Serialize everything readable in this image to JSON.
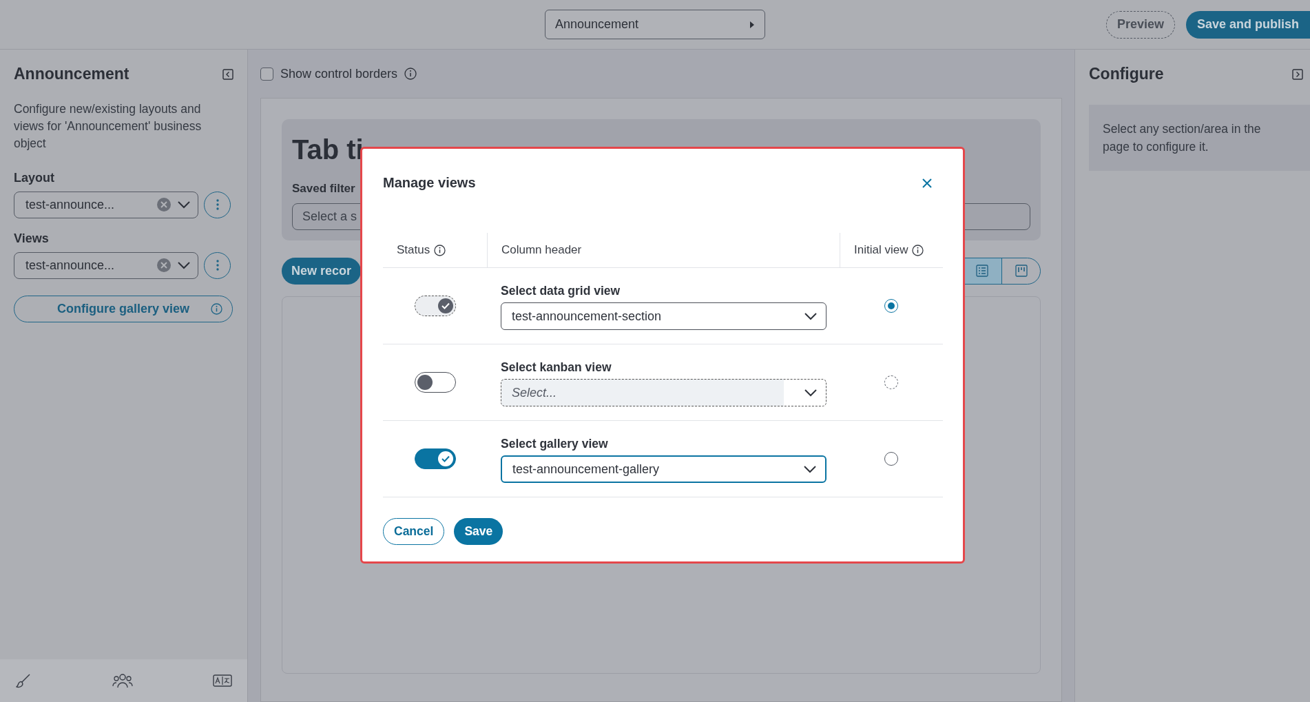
{
  "top_bar": {
    "object_selector": "Announcement",
    "buttons": [
      {
        "label": "Preview",
        "kind": "outline"
      },
      {
        "label": "Save and publish",
        "kind": "primary"
      }
    ]
  },
  "left_panel": {
    "title": "Announcement",
    "description": "Configure new/existing layouts and views for 'Announcement' business object",
    "fields": [
      {
        "label": "Layout",
        "value": "test-announce..."
      },
      {
        "label": "Views",
        "value": "test-announce..."
      }
    ],
    "configure_button": "Configure gallery view"
  },
  "canvas": {
    "show_borders": {
      "label": "Show control borders",
      "checked": false
    },
    "tab_title": "Tab ti",
    "filter_label": "Saved filter",
    "filter_placeholder": "Select a s",
    "new_button": "New recor",
    "view_toggle": [
      {
        "kind": "list",
        "selected": true
      },
      {
        "kind": "kanban",
        "selected": false
      }
    ]
  },
  "right_panel": {
    "title": "Configure",
    "hint": "Select any section/area in the page to configure it."
  },
  "dialog": {
    "title": "Manage views",
    "columns": [
      "Status",
      "Column header",
      "Initial view"
    ],
    "rows": [
      {
        "label": "Select data grid view",
        "toggle": {
          "on": true,
          "disabled": true
        },
        "select": {
          "value": "test-announcement-section",
          "disabled": false,
          "focused": false
        },
        "initial_view": {
          "selected": true,
          "disabled": false
        }
      },
      {
        "label": "Select kanban view",
        "toggle": {
          "on": false,
          "disabled": false
        },
        "select": {
          "placeholder": "Select...",
          "disabled": true,
          "focused": false
        },
        "initial_view": {
          "selected": false,
          "disabled": true
        }
      },
      {
        "label": "Select gallery view",
        "toggle": {
          "on": true,
          "disabled": false
        },
        "select": {
          "value": "test-announcement-gallery",
          "disabled": false,
          "focused": true
        },
        "initial_view": {
          "selected": false,
          "disabled": false
        }
      }
    ],
    "buttons": [
      {
        "label": "Cancel",
        "kind": "outline"
      },
      {
        "label": "Save",
        "kind": "primary"
      }
    ]
  }
}
